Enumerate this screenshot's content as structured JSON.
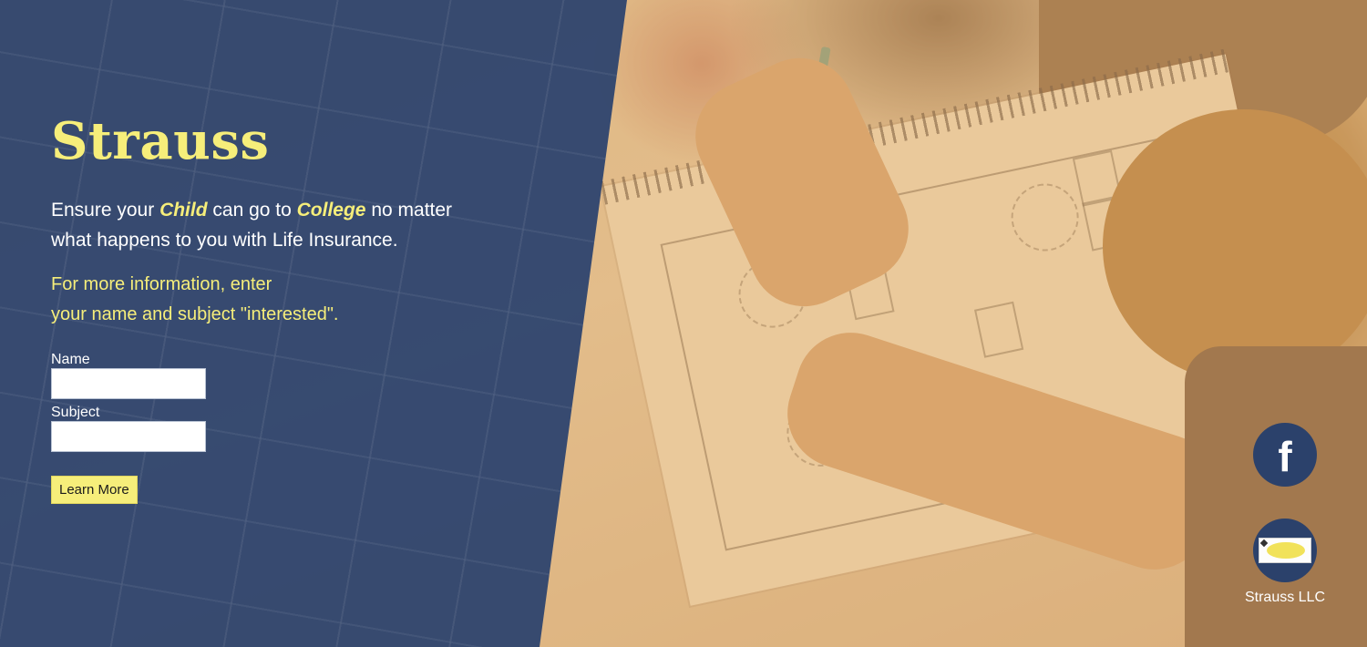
{
  "hero": {
    "title": "Strauss",
    "tagline": {
      "part1": "Ensure your ",
      "em1": "Child",
      "part2": " can go to ",
      "em2": "College",
      "part3": " no matter what happens to you with Life Insurance."
    },
    "info_line1": "For more information, enter",
    "info_line2": "your name and subject \"interested\"."
  },
  "form": {
    "name_label": "Name",
    "name_value": "",
    "subject_label": "Subject",
    "subject_value": "",
    "submit_label": "Learn More"
  },
  "social": {
    "facebook_glyph": "f",
    "facebook_icon": "facebook-icon",
    "company_logo_icon": "company-logo-icon",
    "company_name": "Strauss LLC"
  },
  "colors": {
    "panel_blue": "#2a426e",
    "accent_yellow": "#f6ee7a",
    "icon_circle": "#2b416b"
  }
}
